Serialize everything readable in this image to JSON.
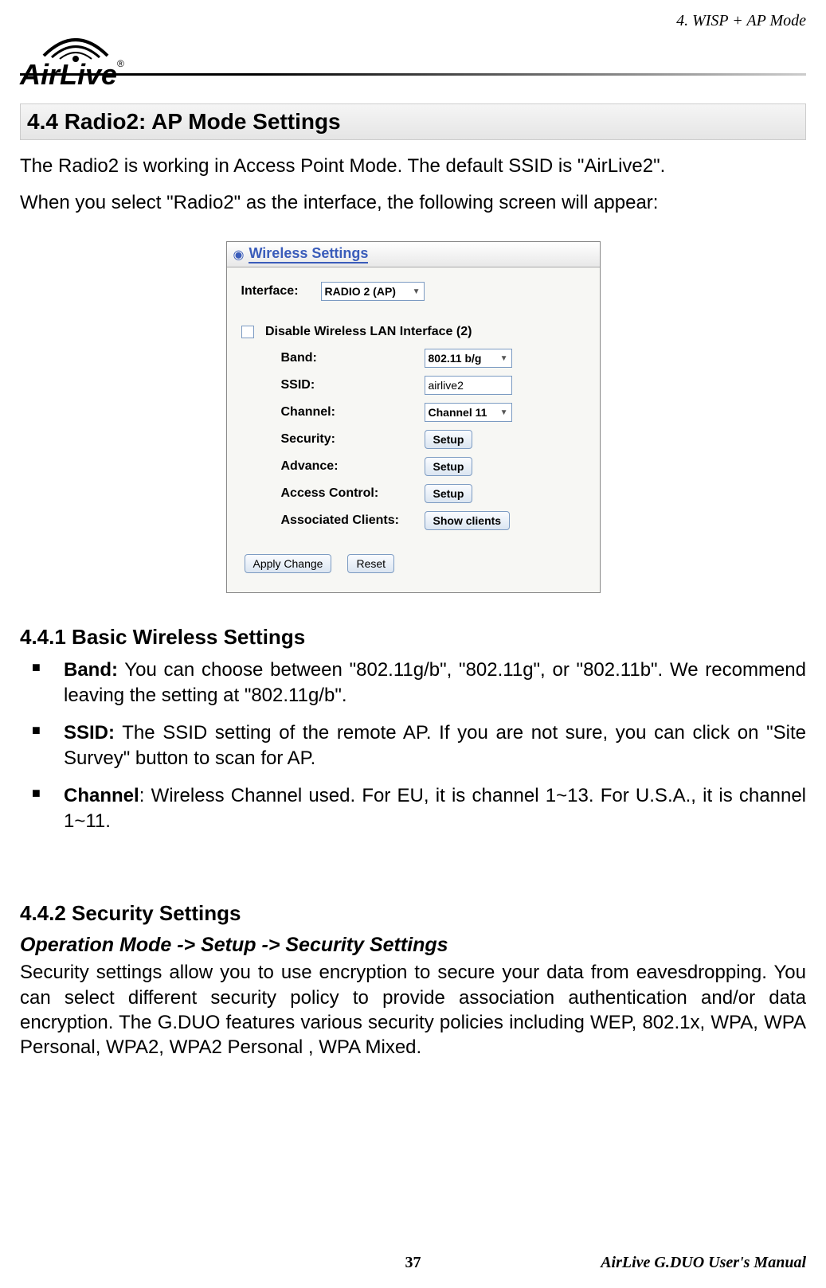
{
  "header": {
    "chapter": "4. WISP + AP Mode",
    "logo": "AirLive",
    "logo_reg": "®"
  },
  "section": {
    "title": "4.4 Radio2:  AP  Mode  Settings",
    "intro1": "The Radio2 is working in Access Point Mode.    The default SSID is \"AirLive2\".",
    "intro2": "When you select \"Radio2\" as the interface, the following screen will appear:"
  },
  "screenshot": {
    "title": "Wireless Settings",
    "interface_label": "Interface:",
    "interface_value": "RADIO 2 (AP)",
    "disable_label": "Disable Wireless LAN Interface (2)",
    "rows": {
      "band_label": "Band:",
      "band_value": "802.11 b/g",
      "ssid_label": "SSID:",
      "ssid_value": "airlive2",
      "channel_label": "Channel:",
      "channel_value": "Channel 11",
      "security_label": "Security:",
      "security_button": "Setup",
      "advance_label": "Advance:",
      "advance_button": "Setup",
      "access_label": "Access Control:",
      "access_button": "Setup",
      "clients_label": "Associated Clients:",
      "clients_button": "Show clients"
    },
    "apply_button": "Apply Change",
    "reset_button": "Reset"
  },
  "sub1": {
    "title": "4.4.1 Basic Wireless Settings",
    "bullets": {
      "band_label": "Band:",
      "band_text": "    You can choose between \"802.11g/b\", \"802.11g\", or \"802.11b\".    We recommend leaving the setting at \"802.11g/b\".",
      "ssid_label": "SSID:",
      "ssid_text": "    The SSID setting of the remote AP.    If you are not sure, you can click on \"Site Survey\" button to scan for AP.",
      "channel_label": "Channel",
      "channel_text": ":    Wireless Channel used.    For EU, it is channel 1~13.    For U.S.A., it is channel 1~11."
    }
  },
  "sub2": {
    "title": "4.4.2 Security Settings",
    "subtitle": "Operation Mode -> Setup -> Security Settings",
    "body": "Security settings allow you to use encryption to secure your data from eavesdropping.  You can select different security policy to provide association authentication and/or data encryption.   The G.DUO features various security policies including WEP, 802.1x, WPA, WPA Personal, WPA2, WPA2 Personal , WPA Mixed."
  },
  "footer": {
    "page": "37",
    "manual": "AirLive  G.DUO  User's  Manual"
  }
}
